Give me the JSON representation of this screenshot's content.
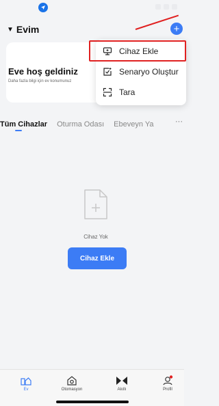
{
  "status_bar": {
    "location_icon": "navigation-arrow-icon"
  },
  "header": {
    "home_name": "Evim",
    "add_icon": "plus-circle-icon"
  },
  "welcome_card": {
    "title": "Eve hoş geldiniz",
    "subtitle": "Daha fazla bilgi için ev konumunuz"
  },
  "popup_menu": {
    "items": [
      {
        "label": "Cihaz Ekle",
        "icon": "device-add-icon"
      },
      {
        "label": "Senaryo Oluştur",
        "icon": "scene-create-icon"
      },
      {
        "label": "Tara",
        "icon": "scan-icon"
      }
    ],
    "highlight_color": "#e02020"
  },
  "tabs": {
    "items": [
      "Tüm Cihazlar",
      "Oturma Odası",
      "Ebeveyn Ya"
    ],
    "more": "···"
  },
  "empty_state": {
    "text": "Cihaz Yok",
    "button_label": "Cihaz Ekle"
  },
  "bottom_nav": {
    "items": [
      {
        "label": "Ev",
        "icon": "home-icon"
      },
      {
        "label": "Otomasyon",
        "icon": "automation-icon"
      },
      {
        "label": "Akıllı",
        "icon": "smart-icon"
      },
      {
        "label": "Profil",
        "icon": "profile-icon"
      }
    ]
  },
  "colors": {
    "accent": "#3c7cf5",
    "annotation": "#e02020",
    "background": "#f3f4f6"
  }
}
